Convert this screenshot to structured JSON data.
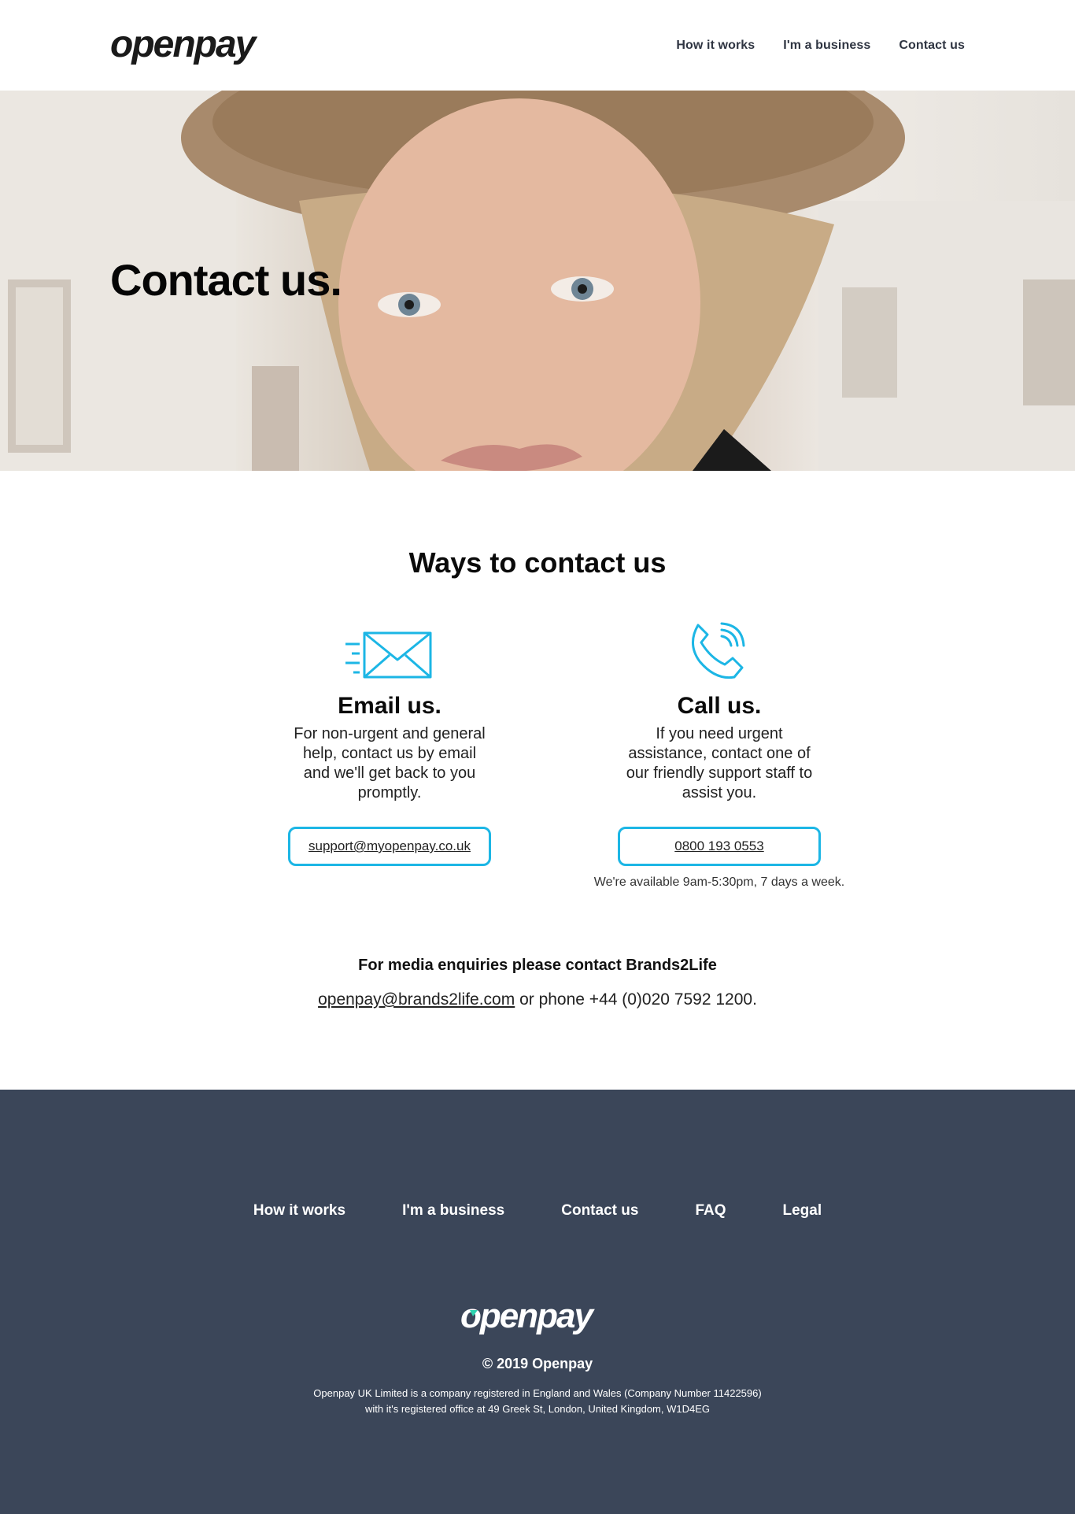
{
  "header": {
    "logo_text": "openpay",
    "nav": [
      "How it works",
      "I'm a business",
      "Contact us"
    ]
  },
  "hero": {
    "title": "Contact us."
  },
  "contact": {
    "heading": "Ways to contact us",
    "email": {
      "icon": "envelope-icon",
      "title": "Email us.",
      "text": "For non-urgent and general help, contact us by email and we'll get back to you promptly.",
      "button": "support@myopenpay.co.uk"
    },
    "call": {
      "icon": "phone-icon",
      "title": "Call us.",
      "text": "If you need urgent assistance, contact one of our friendly support staff to assist you.",
      "button": "0800 193 0553",
      "availability": "We're available 9am-5:30pm, 7 days a week."
    },
    "media": {
      "title": "For media enquiries please contact Brands2Life",
      "email": "openpay@brands2life.com",
      "phone_text": " or phone +44 (0)020 7592 1200."
    }
  },
  "footer": {
    "nav": [
      "How it works",
      "I'm a business",
      "Contact us",
      "FAQ",
      "Legal"
    ],
    "logo_text": "openpay",
    "copyright": "© 2019 Openpay",
    "legal_line1": "Openpay UK Limited is a company registered in England and Wales (Company Number 11422596)",
    "legal_line2": "with it's registered office at 49 Greek St, London, United Kingdom, W1D4EG"
  },
  "colors": {
    "accent": "#1cb6e5",
    "footer_bg": "#3b4659",
    "logo_accent": "#2fd3b0"
  }
}
